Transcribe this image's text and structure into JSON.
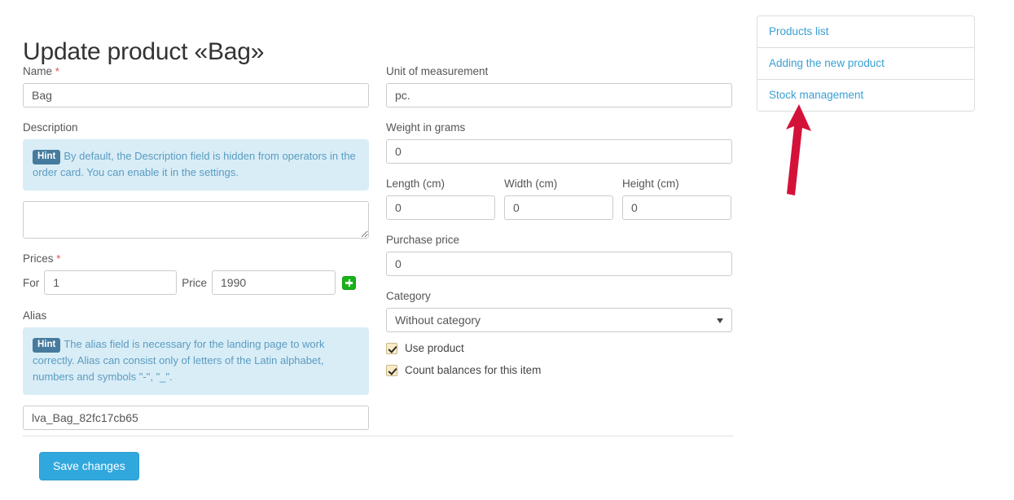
{
  "page": {
    "title": "Update product «Bag»"
  },
  "form": {
    "required_mark": "*",
    "name": {
      "label": "Name",
      "value": "Bag",
      "placeholder": ""
    },
    "description": {
      "label": "Description",
      "hint_badge": "Hint",
      "hint_text": "By default, the Description field is hidden from operators in the order card. You can enable it in the settings.",
      "value": "",
      "placeholder": ""
    },
    "prices": {
      "label": "Prices",
      "for_label": "For",
      "for_value": "1",
      "price_label": "Price",
      "price_value": "1990",
      "add_button_icon": "plus-icon"
    },
    "alias": {
      "label": "Alias",
      "hint_badge": "Hint",
      "hint_text": "The alias field is necessary for the landing page to work correctly. Alias can consist only of letters of the Latin alphabet, numbers and symbols \"-\", \"_\".",
      "value": "lva_Bag_82fc17cb65",
      "placeholder": ""
    },
    "unit": {
      "label": "Unit of measurement",
      "value": "pc.",
      "placeholder": ""
    },
    "weight": {
      "label": "Weight in grams",
      "value": "0",
      "placeholder": ""
    },
    "length": {
      "label": "Length (cm)",
      "value": "0",
      "placeholder": ""
    },
    "width": {
      "label": "Width (cm)",
      "value": "0",
      "placeholder": ""
    },
    "height": {
      "label": "Height (cm)",
      "value": "0",
      "placeholder": ""
    },
    "purchase_price": {
      "label": "Purchase price",
      "value": "0",
      "placeholder": ""
    },
    "category": {
      "label": "Category",
      "selected": "Without category",
      "options": [
        "Without category"
      ],
      "caret_icon": "chevron-down-icon"
    },
    "use_product": {
      "label": "Use product",
      "checked": true
    },
    "count_balances": {
      "label": "Count balances for this item",
      "checked": true
    },
    "submit": {
      "label": "Save changes"
    }
  },
  "sidebar": {
    "items": [
      {
        "label": "Products list"
      },
      {
        "label": "Adding the new product"
      },
      {
        "label": "Stock management"
      }
    ]
  },
  "annotation": {
    "arrow_icon": "arrow-up-icon",
    "arrow_color": "#d41239",
    "points_at": "Stock management"
  },
  "colors": {
    "accent_blue": "#31a8dd",
    "link_blue": "#3a9fd4",
    "hint_bg": "#d9edf7",
    "hint_badge_bg": "#467b9e",
    "hint_text": "#5a9cc0",
    "add_green": "#19b319",
    "required_red": "#e8473f",
    "checkbox_bg": "#faebc8"
  }
}
